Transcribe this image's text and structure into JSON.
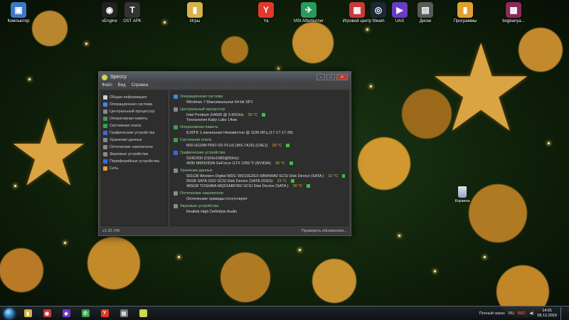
{
  "desktop": {
    "icons": [
      {
        "label": "Компьютер",
        "color": "#3c78c8",
        "glyph": "▣"
      },
      {
        "label": "sEngine",
        "color": "#222222",
        "glyph": "◉"
      },
      {
        "label": "OST APK",
        "color": "#333333",
        "glyph": "T"
      },
      {
        "label": "Игры",
        "color": "#d7b24a",
        "glyph": "▮"
      },
      {
        "label": "Ya",
        "color": "#e03a2a",
        "glyph": "Y"
      },
      {
        "label": "MSI Afterburner",
        "color": "#2a9a5a",
        "glyph": "✈"
      },
      {
        "label": "Игровой центр",
        "color": "#c83a3a",
        "glyph": "▦"
      },
      {
        "label": "Steam",
        "color": "#1b2838",
        "glyph": "◎"
      },
      {
        "label": "UAS",
        "color": "#6a3ac8",
        "glyph": "▶"
      },
      {
        "label": "Диски",
        "color": "#5a5a5a",
        "glyph": "▤"
      },
      {
        "label": "Программы",
        "color": "#e0a030",
        "glyph": "▮"
      },
      {
        "label": "bogbanya...",
        "color": "#8a2a5a",
        "glyph": "▦"
      }
    ],
    "recycle_bin": {
      "label": "Корзина"
    }
  },
  "window": {
    "title": "Speccy",
    "menu": [
      "Файл",
      "Вид",
      "Справка"
    ],
    "nav": [
      {
        "label": "Общая информация",
        "color": "#d0d0d0"
      },
      {
        "label": "Операционная система",
        "color": "#3a8ae0"
      },
      {
        "label": "Центральный процессор",
        "color": "#8a8a8a"
      },
      {
        "label": "Оперативная память",
        "color": "#3aa04a"
      },
      {
        "label": "Системная плата",
        "color": "#3aa04a"
      },
      {
        "label": "Графические устройства",
        "color": "#3a6ae0"
      },
      {
        "label": "Хранение данных",
        "color": "#8a8a8a"
      },
      {
        "label": "Оптические накопители",
        "color": "#8a8a8a"
      },
      {
        "label": "Звуковые устройства",
        "color": "#8a8a8a"
      },
      {
        "label": "Периферийные устройства",
        "color": "#3a6ae0"
      },
      {
        "label": "Сеть",
        "color": "#e0a030"
      }
    ],
    "sections": [
      {
        "heading": "Операционная система",
        "color": "#3a8ae0",
        "lines": [
          {
            "text": "Windows 7 Максимальная 64-bit SP1",
            "temp": ""
          }
        ]
      },
      {
        "heading": "Центральный процессор",
        "color": "#8a8a8a",
        "lines": [
          {
            "text": "Intel Pentium G4600 @ 3.60GHz",
            "temp": "39 °C"
          },
          {
            "text": "Технология Kaby Lake 14нм",
            "temp": ""
          }
        ]
      },
      {
        "heading": "Оперативная память",
        "color": "#3aa04a",
        "lines": [
          {
            "text": "8,00ГБ 1-канальная Неизвестно @ 1196 МГц (17-17-17-39)",
            "temp": ""
          }
        ]
      },
      {
        "heading": "Системная плата",
        "color": "#3aa04a",
        "lines": [
          {
            "text": "MSI H110M PRO-VD PLUS (MS-7A15) (U3E1)",
            "temp": "28 °C"
          }
        ]
      },
      {
        "heading": "Графические устройства",
        "color": "#3a6ae0",
        "lines": [
          {
            "text": "S24D300 (1920x1080@60Hz)",
            "temp": ""
          },
          {
            "text": "4095 МБNVIDIA GeForce GTX 1050 Ti (NVIDIA)",
            "temp": "28 °C"
          }
        ]
      },
      {
        "heading": "Хранение данных",
        "color": "#8a8a8a",
        "lines": [
          {
            "text": "931GB Western Digital WDC WD10EZEX-08WN4A0 SCSI Disk Device (SATA )",
            "temp": "31 °C"
          },
          {
            "text": "55GB SATA SSD SCSI Disk Device (SATA (SSD))",
            "temp": "33 °C"
          },
          {
            "text": "465GB TOSHIBA MQ01ABF050 SCSI Disk Device (SATA )",
            "temp": "30 °C"
          }
        ]
      },
      {
        "heading": "Оптические накопители",
        "color": "#8a8a8a",
        "lines": [
          {
            "text": "Оптические приводы отсутствуют",
            "temp": ""
          }
        ]
      },
      {
        "heading": "Звуковые устройства",
        "color": "#8a8a8a",
        "lines": [
          {
            "text": "Realtek High Definition Audio",
            "temp": ""
          }
        ]
      }
    ],
    "version": "v1.32.740",
    "update_link": "Проверить обновления..."
  },
  "taskbar": {
    "apps": [
      {
        "name": "explorer",
        "color": "#d7b24a",
        "glyph": "▮"
      },
      {
        "name": "media",
        "color": "#c83a3a",
        "glyph": "◉"
      },
      {
        "name": "vs",
        "color": "#6a3ac8",
        "glyph": "◆"
      },
      {
        "name": "phone",
        "color": "#3aa04a",
        "glyph": "✆"
      },
      {
        "name": "yandex",
        "color": "#e03a2a",
        "glyph": "Y"
      },
      {
        "name": "tool",
        "color": "#777777",
        "glyph": "▤"
      },
      {
        "name": "speccy",
        "color": "#cfd64a",
        "glyph": "◌"
      }
    ],
    "tray": {
      "fullscreen": "Полный экран",
      "lang": "RU",
      "rec": "REC",
      "time": "14:01",
      "date": "05.12.2019"
    }
  }
}
